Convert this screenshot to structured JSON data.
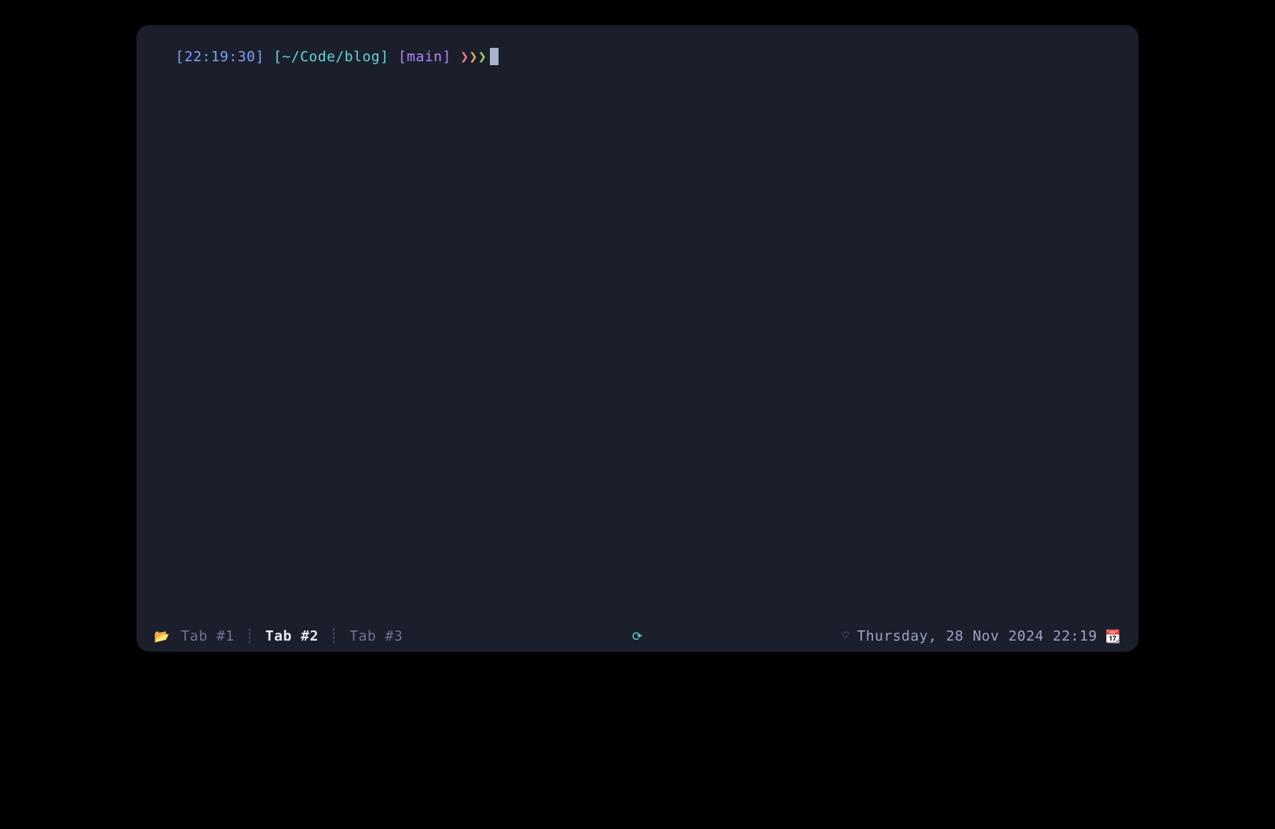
{
  "prompt": {
    "time": "[22:19:30]",
    "path": "[~/Code/blog]",
    "branch": "[main]",
    "chev1": "❯",
    "chev2": "❯",
    "chev3": "❯"
  },
  "statusbar": {
    "folder_icon": "📂",
    "tabs": [
      {
        "label": "Tab #1",
        "active": false
      },
      {
        "label": "Tab #2",
        "active": true
      },
      {
        "label": "Tab #3",
        "active": false
      }
    ],
    "separator": "┊",
    "center_icon": "⟳",
    "heart_icon": "♡",
    "datetime": "Thursday, 28 Nov 2024 22:19",
    "calendar_icon": "📆"
  }
}
